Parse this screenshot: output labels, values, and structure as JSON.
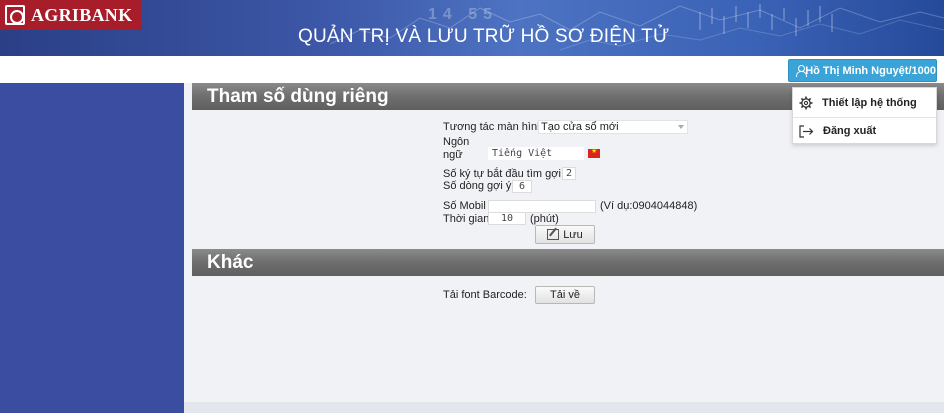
{
  "header": {
    "logo_text": "AGRIBANK",
    "title": "QUẢN TRỊ VÀ LƯU TRỮ HỒ SƠ ĐIỆN TỬ",
    "ticker_numbers": "14 55",
    "user_label": "Hồ Thị Minh Nguyệt/1000"
  },
  "user_menu": {
    "items": [
      {
        "label": "Thiết lập hệ thống",
        "icon": "gear-icon"
      },
      {
        "label": "Đăng xuất",
        "icon": "logout-icon"
      }
    ]
  },
  "sections": {
    "private": {
      "title": "Tham số dùng riêng",
      "screen_interaction_label": "Tương tác màn hình:",
      "screen_interaction_value": "Tạo cửa sổ mới",
      "language_label_1": "Ngôn",
      "language_label_2": "ngữ",
      "language_value": "Tiếng Việt",
      "suggest_start_label": "Số ký tự bắt đầu tìm gợi ý:",
      "suggest_start_value": "2",
      "suggest_rows_label": "Số dòng gợi ý:",
      "suggest_rows_value": "6",
      "mobile_label": "Số Mobil",
      "mobile_value": "",
      "mobile_hint": "(Ví dụ:0904044848)",
      "time_label": "Thời gian",
      "time_value": "10",
      "time_unit": "(phút)",
      "save_label": "Lưu"
    },
    "other": {
      "title": "Khác",
      "barcode_label": "Tải font Barcode:",
      "download_label": "Tải về"
    }
  },
  "colors": {
    "sidebar": "#3b4da0",
    "user_button": "#3aa3d8",
    "logo": "#a71d2a"
  }
}
